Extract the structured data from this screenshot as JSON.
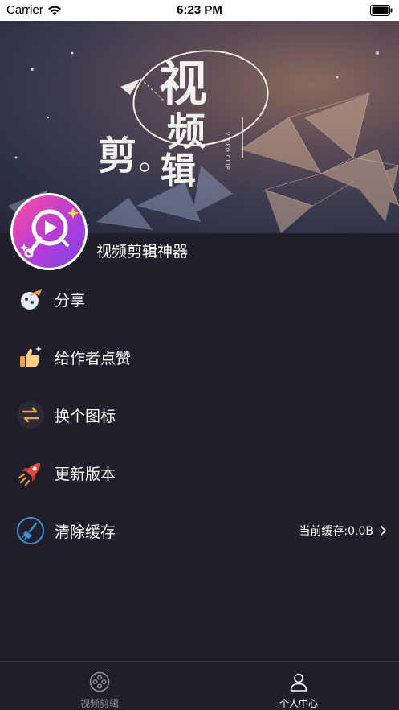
{
  "status_bar": {
    "carrier": "Carrier",
    "time": "6:23 PM"
  },
  "banner": {
    "chars": [
      "视",
      "频",
      "剪",
      "辑"
    ],
    "small_text": "VIDEO CLIP"
  },
  "profile": {
    "app_name": "视频剪辑神器"
  },
  "menu": [
    {
      "id": "share",
      "label": "分享",
      "icon": "share-icon"
    },
    {
      "id": "like",
      "label": "给作者点赞",
      "icon": "thumbs-up-icon"
    },
    {
      "id": "change-icon",
      "label": "换个图标",
      "icon": "swap-icon"
    },
    {
      "id": "update",
      "label": "更新版本",
      "icon": "rocket-icon"
    },
    {
      "id": "clear-cache",
      "label": "清除缓存",
      "icon": "broom-icon",
      "detail": "当前缓存:0.0B"
    }
  ],
  "tabs": [
    {
      "label": "视频剪辑",
      "icon": "film-reel-icon",
      "active": false
    },
    {
      "label": "个人中心",
      "icon": "person-icon",
      "active": true
    }
  ],
  "colors": {
    "background": "#1f1e29",
    "tab_inactive": "#8e8d98",
    "tab_active": "#ffffff",
    "accent_orange": "#f2a23a"
  }
}
